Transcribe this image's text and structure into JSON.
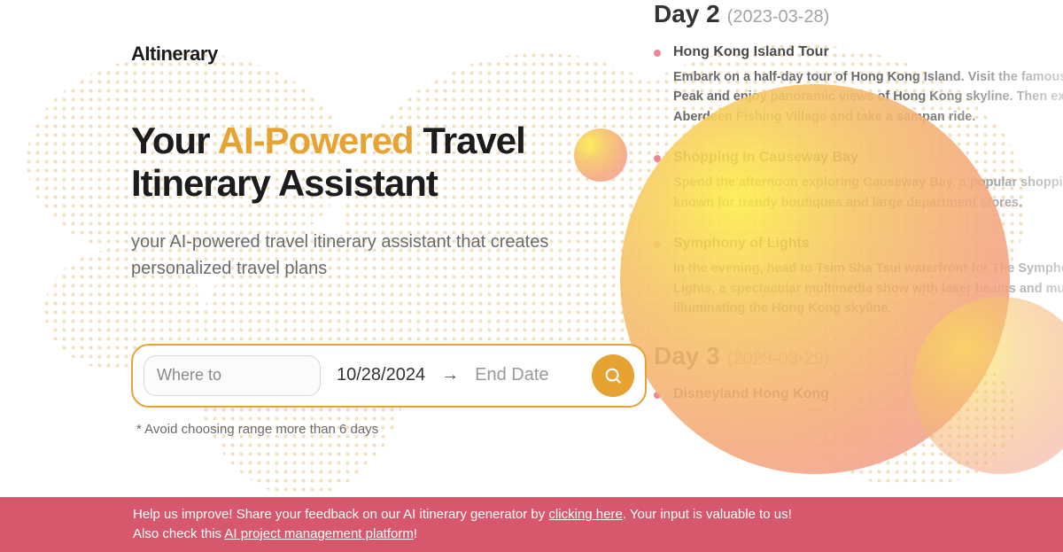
{
  "brand": "AItinerary",
  "headline": {
    "pre": "Your ",
    "accent": "AI-Powered",
    "post": " Travel Itinerary Assistant"
  },
  "subhead": "your AI-powered travel itinerary assistant that creates personalized travel plans",
  "search": {
    "where_placeholder": "Where to",
    "start_date": "10/28/2024",
    "end_date_placeholder": "End Date",
    "arrow": "→"
  },
  "disclaimer": "* Avoid choosing range more than 6 days",
  "banner": {
    "line1_pre": "Help us improve! Share your feedback on our AI itinerary generator by ",
    "line1_link": "clicking here",
    "line1_post": ". Your input is valuable to us!",
    "line2_pre": "Also check this ",
    "line2_link": "AI project management platform",
    "line2_post": "!"
  },
  "preview": {
    "day2_label": "Day 2",
    "day2_date": "(2023-03-28)",
    "day2_a1_title": "Hong Kong Island Tour",
    "day2_a1_body": "Embark on a half-day tour of Hong Kong Island. Visit the famous Victoria Peak and enjoy panoramic views of Hong Kong skyline. Then explore Aberdeen Fishing Village and take a sampan ride.",
    "day2_a2_title": "Shopping in Causeway Bay",
    "day2_a2_body": "Spend the afternoon exploring Causeway Bay, a popular shopping district known for trendy boutiques and large department stores.",
    "day2_a3_title": "Symphony of Lights",
    "day2_a3_body": "In the evening, head to Tsim Sha Tsui waterfront for The Symphony of Lights, a spectacular multimedia show with laser beams and music illuminating the Hong Kong skyline.",
    "day3_label": "Day 3",
    "day3_date": "(2023-03-29)",
    "day3_a1_title": "Disneyland Hong Kong"
  }
}
